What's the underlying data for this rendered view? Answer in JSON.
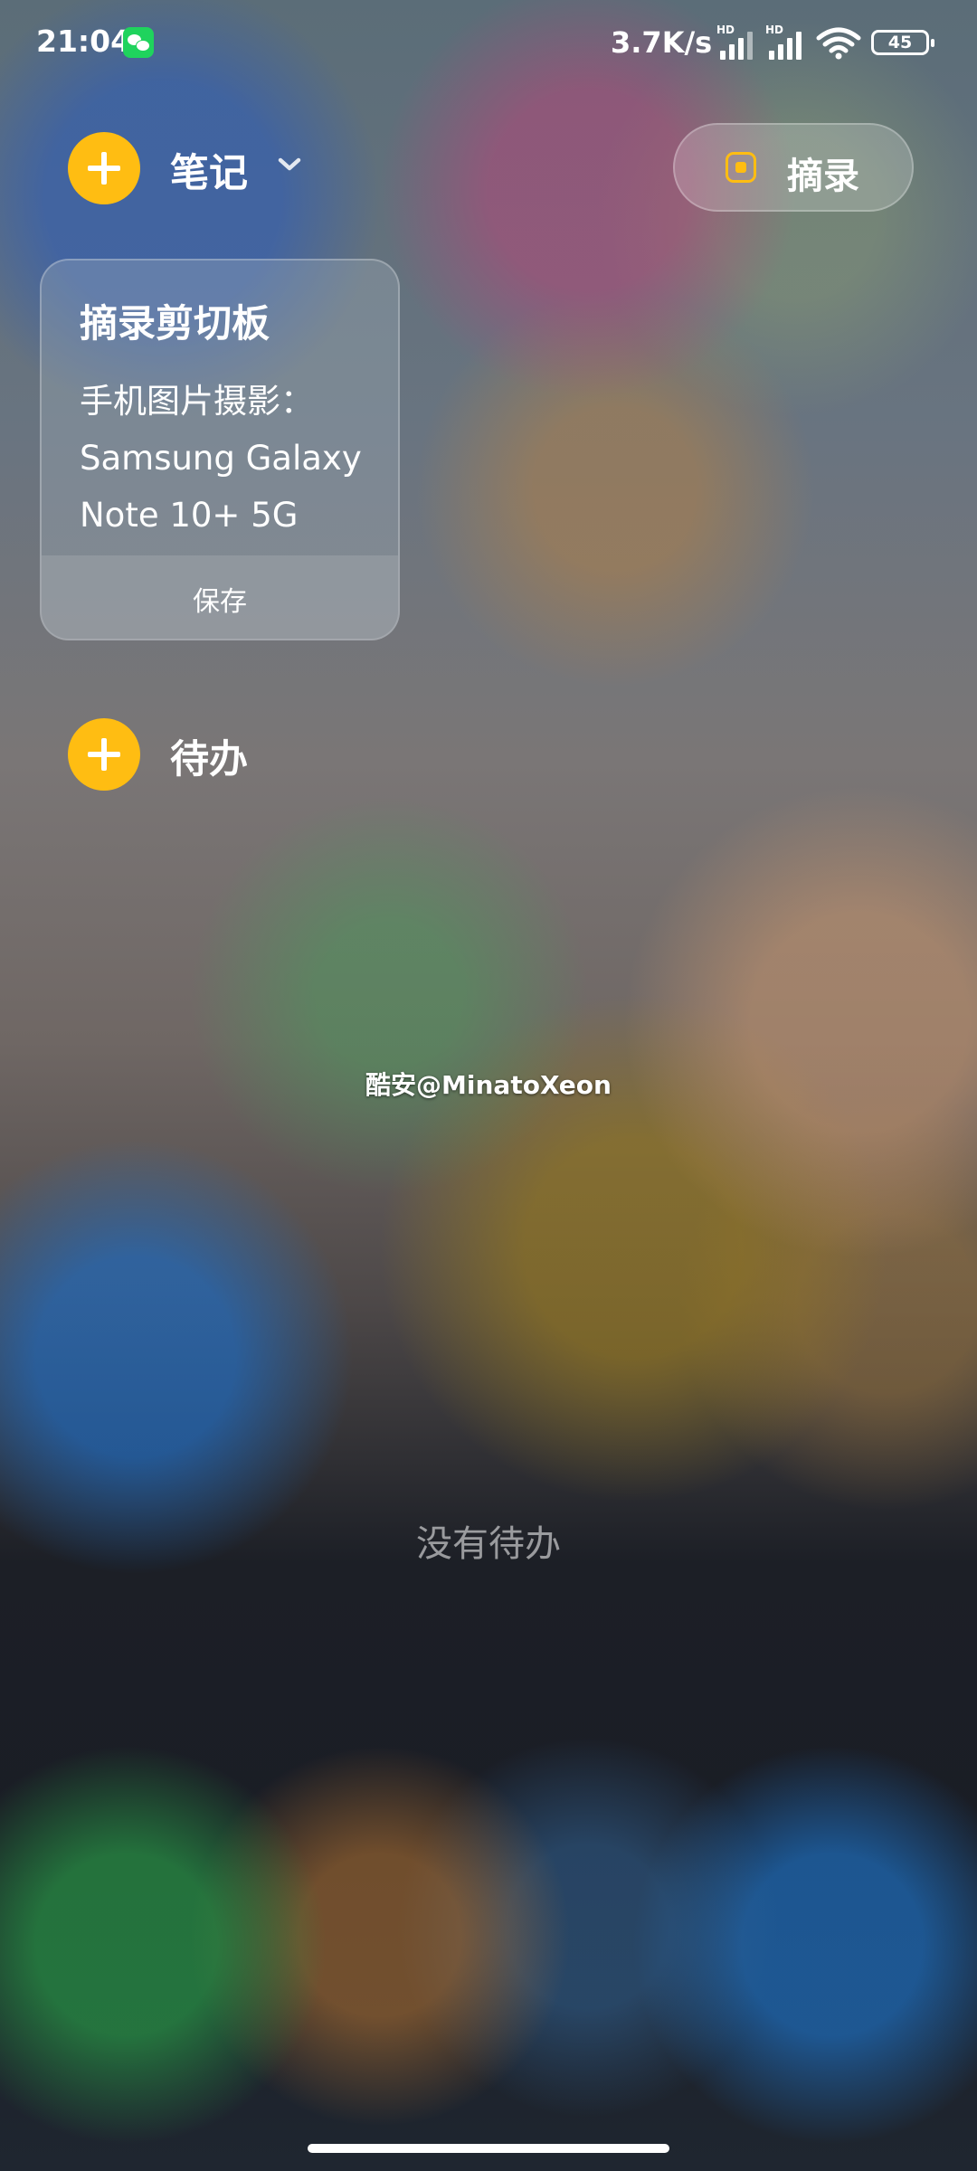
{
  "status_bar": {
    "time": "21:04",
    "net_speed": "3.7K/s",
    "sim1_label": "HD",
    "sim2_label": "HD",
    "battery": "45",
    "notification_icon": "wechat-icon"
  },
  "notes": {
    "title": "笔记",
    "add_icon": "plus-icon",
    "dropdown_icon": "chevron-down-icon"
  },
  "excerpt_button": {
    "label": "摘录",
    "icon": "clipboard-square-icon",
    "accent_color": "#ffbd12"
  },
  "clipboard_card": {
    "title": "摘录剪切板",
    "content": "手机图片摄影：\nSamsung Galaxy\nNote 10+ 5G",
    "save_label": "保存"
  },
  "todo": {
    "title": "待办",
    "empty_text": "没有待办"
  },
  "watermark": "酷安@MinatoXeon"
}
